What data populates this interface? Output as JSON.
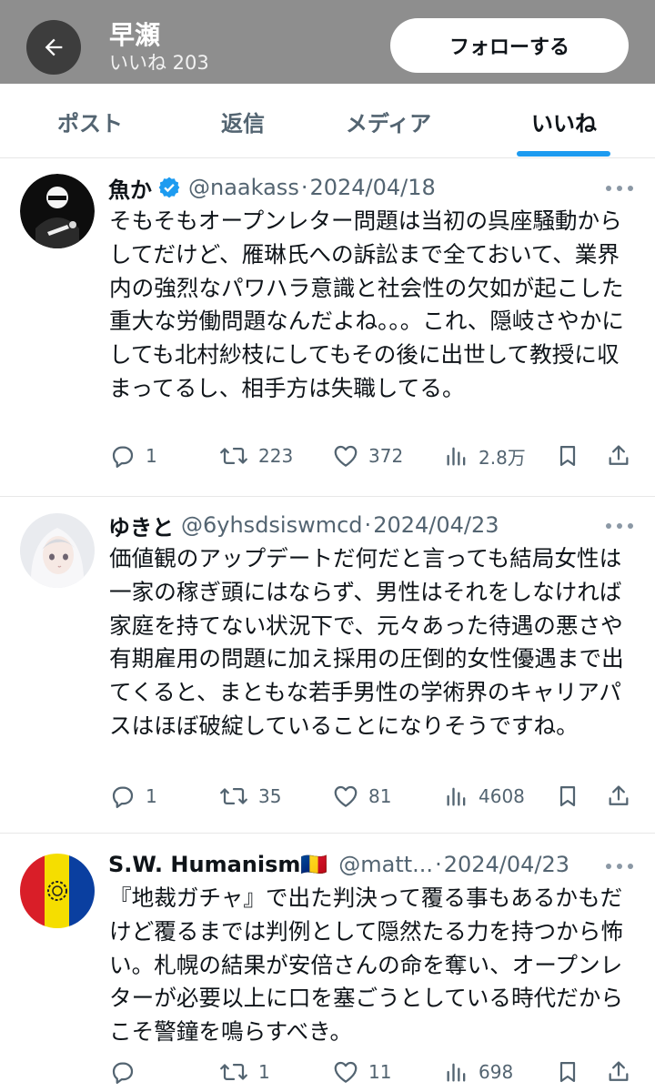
{
  "header": {
    "title": "早瀬",
    "subtitle": "いいね 203",
    "follow_label": "フォローする"
  },
  "tabs": [
    {
      "label": "ポスト"
    },
    {
      "label": "返信"
    },
    {
      "label": "メディア"
    },
    {
      "label": "いいね",
      "active": true
    }
  ],
  "accent_color": "#1d9bf0",
  "posts": [
    {
      "name": "魚か",
      "verified": true,
      "handle": "@naakass",
      "date": "2024/04/18",
      "text": "そもそもオープンレター問題は当初の呉座騒動からしてだけど、雁琳氏への訴訟まで全ておいて、業界内の強烈なパワハラ意識と社会性の欠如が起こした重大な労働問題なんだよね。。。これ、隠岐さやかにしても北村紗枝にしてもその後に出世して教授に収まってるし、相手方は失職してる。",
      "replies": "1",
      "reposts": "223",
      "likes": "372",
      "views": "2.8万"
    },
    {
      "name": "ゆきと",
      "verified": false,
      "handle": "@6yhsdsiswmcd",
      "date": "2024/04/23",
      "text": "価値観のアップデートだ何だと言っても結局女性は一家の稼ぎ頭にはならず、男性はそれをしなければ家庭を持てない状況下で、元々あった待遇の悪さや有期雇用の問題に加え採用の圧倒的女性優遇まで出てくると、まともな若手男性の学術界のキャリアパスはほぼ破綻していることになりそうですね。",
      "replies": "1",
      "reposts": "35",
      "likes": "81",
      "views": "4608"
    },
    {
      "name": "S.W. Humanism🇷🇴",
      "verified": false,
      "handle": "@matt...",
      "date": "2024/04/23",
      "text": "『地裁ガチャ』で出た判決って覆る事もあるかもだけど覆るまでは判例として隠然たる力を持つから怖い。札幌の結果が安倍さんの命を奪い、オープンレターが必要以上に口を塞ごうとしている時代だからこそ警鐘を鳴らすべき。",
      "replies": "",
      "reposts": "1",
      "likes": "11",
      "views": "698"
    }
  ]
}
